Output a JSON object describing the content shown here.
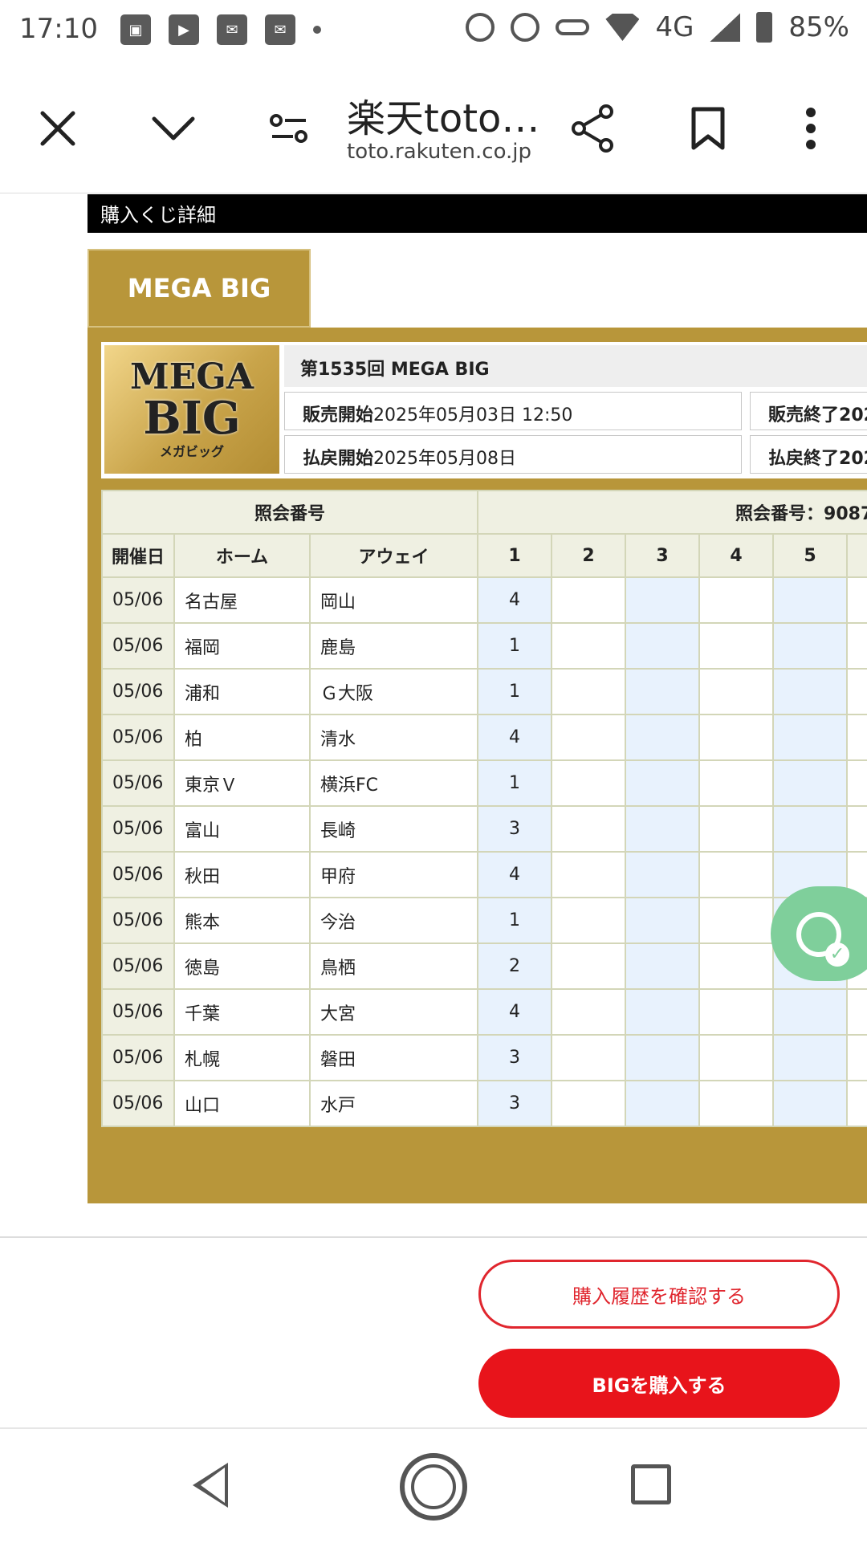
{
  "status_bar": {
    "time": "17:10",
    "network": "4G",
    "battery": "85%",
    "icons": [
      "image-icon",
      "play-icon",
      "au-mail-icon",
      "au-mail-icon",
      "dot-icon",
      "alarm-icon",
      "data-saver-icon",
      "vpn-key-icon",
      "wifi-icon",
      "signal-icon",
      "battery-icon"
    ]
  },
  "browser": {
    "title": "楽天toto…",
    "url": "toto.rakuten.co.jp"
  },
  "page": {
    "section_title": "購入くじ詳細",
    "tab_label": "MEGA BIG",
    "logo": {
      "line1": "MEGA",
      "line2": "BIG",
      "line3": "メガビッグ"
    },
    "draw_title": "第1535回 MEGA BIG",
    "sale_start_label": "販売開始",
    "sale_start_value": "2025年05月03日 12:50",
    "sale_end_label": "販売終了",
    "sale_end_value": "202",
    "payout_start_label": "払戻開始",
    "payout_start_value": "2025年05月08日",
    "payout_end_label": "払戻終了",
    "payout_end_value": "202",
    "ref_header_left": "照会番号",
    "ref_header_right": "照会番号：9087-",
    "columns": {
      "date": "開催日",
      "home": "ホーム",
      "away": "アウェイ",
      "n1": "1",
      "n2": "2",
      "n3": "3",
      "n4": "4",
      "n5": "5"
    },
    "rows": [
      {
        "date": "05/06",
        "home": "名古屋",
        "away": "岡山",
        "pick": "4"
      },
      {
        "date": "05/06",
        "home": "福岡",
        "away": "鹿島",
        "pick": "1"
      },
      {
        "date": "05/06",
        "home": "浦和",
        "away": "Ｇ大阪",
        "pick": "1"
      },
      {
        "date": "05/06",
        "home": "柏",
        "away": "清水",
        "pick": "4"
      },
      {
        "date": "05/06",
        "home": "東京Ｖ",
        "away": "横浜FC",
        "pick": "1"
      },
      {
        "date": "05/06",
        "home": "富山",
        "away": "長崎",
        "pick": "3"
      },
      {
        "date": "05/06",
        "home": "秋田",
        "away": "甲府",
        "pick": "4"
      },
      {
        "date": "05/06",
        "home": "熊本",
        "away": "今治",
        "pick": "1"
      },
      {
        "date": "05/06",
        "home": "徳島",
        "away": "鳥栖",
        "pick": "2"
      },
      {
        "date": "05/06",
        "home": "千葉",
        "away": "大宮",
        "pick": "4"
      },
      {
        "date": "05/06",
        "home": "札幌",
        "away": "磐田",
        "pick": "3"
      },
      {
        "date": "05/06",
        "home": "山口",
        "away": "水戸",
        "pick": "3"
      }
    ]
  },
  "buttons": {
    "history": "購入履歴を確認する",
    "buy": "BIGを購入する"
  },
  "colors": {
    "gold": "#b8963a",
    "accent_red": "#e8141b",
    "table_header": "#eff0e2",
    "pick_column": "#e8f2fd",
    "fab_green": "#7fcf9b"
  }
}
